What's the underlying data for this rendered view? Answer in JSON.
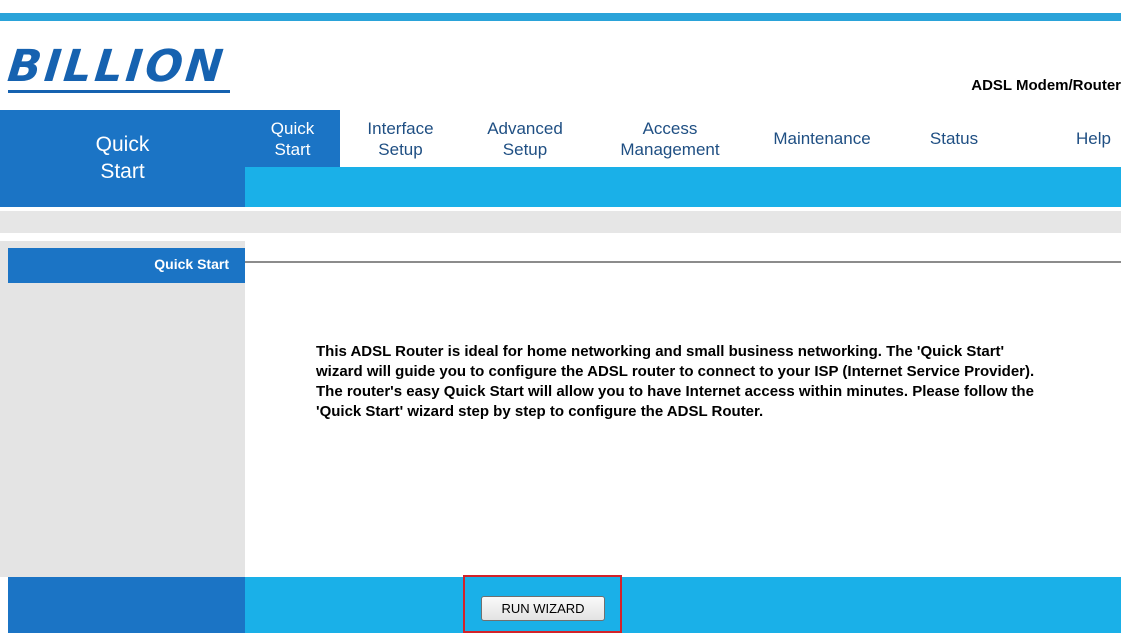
{
  "brand": {
    "logo": "BILLION",
    "product": "ADSL Modem/Router"
  },
  "left_header": {
    "line1": "Quick",
    "line2": "Start"
  },
  "nav": {
    "items": [
      {
        "line1": "Quick",
        "line2": "Start",
        "active": true
      },
      {
        "line1": "Interface",
        "line2": "Setup"
      },
      {
        "line1": "Advanced",
        "line2": "Setup"
      },
      {
        "line1": "Access",
        "line2": "Management"
      },
      {
        "line1": "Maintenance",
        "line2": ""
      },
      {
        "line1": "Status",
        "line2": ""
      },
      {
        "line1": "Help",
        "line2": ""
      }
    ]
  },
  "section": {
    "label": "Quick Start"
  },
  "content": {
    "description": "This ADSL Router is ideal for home networking and small business networking. The 'Quick Start' wizard will guide you to configure the ADSL router to connect to your ISP (Internet Service Provider). The router's easy Quick Start will allow you to have Internet access within minutes. Please follow the 'Quick Start' wizard step by step to configure the ADSL Router."
  },
  "footer": {
    "run_wizard_label": "RUN WIZARD"
  },
  "colors": {
    "primary_blue": "#1b74c5",
    "light_blue": "#1ab0e8",
    "highlight_red": "#d3232a"
  }
}
